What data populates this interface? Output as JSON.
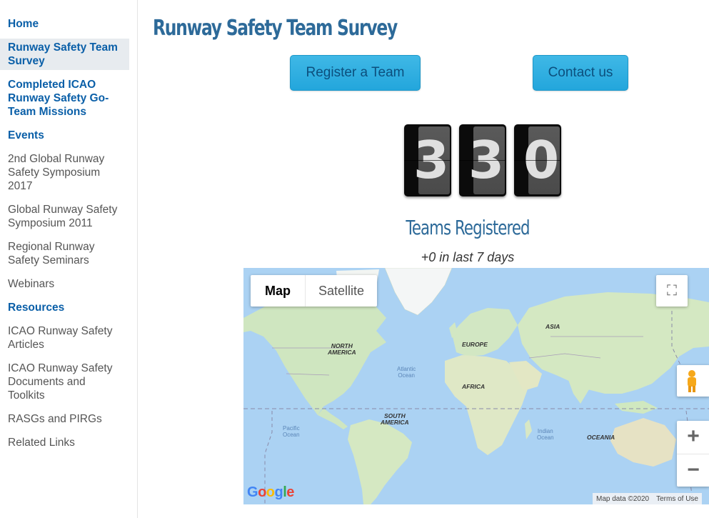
{
  "sidebar": {
    "items": [
      {
        "label": "Home",
        "style": "bold"
      },
      {
        "label": "Runway Safety Team Survey",
        "style": "bold",
        "active": true
      },
      {
        "label": "Completed ICAO Runway Safety Go-Team Missions",
        "style": "bold"
      },
      {
        "label": "Events",
        "style": "bold"
      },
      {
        "label": "2nd Global Runway Safety Symposium 2017",
        "style": "plain"
      },
      {
        "label": "Global Runway Safety Symposium 2011",
        "style": "plain"
      },
      {
        "label": "Regional Runway Safety Seminars",
        "style": "plain"
      },
      {
        "label": "Webinars",
        "style": "plain"
      },
      {
        "label": "Resources",
        "style": "bold"
      },
      {
        "label": "ICAO Runway Safety Articles",
        "style": "plain"
      },
      {
        "label": "ICAO Runway Safety Documents and Toolkits",
        "style": "plain"
      },
      {
        "label": "RASGs and PIRGs",
        "style": "plain"
      },
      {
        "label": "Related Links",
        "style": "plain"
      }
    ]
  },
  "main": {
    "title": "Runway Safety Team Survey",
    "register_button": "Register a Team",
    "contact_button": "Contact us",
    "counter": {
      "digits": [
        "3",
        "3",
        "0"
      ],
      "value": 330
    },
    "counter_label": "Teams Registered",
    "weekly_change": "+0 in last 7 days"
  },
  "map": {
    "type_map": "Map",
    "type_satellite": "Satellite",
    "fullscreen_icon": "⛶",
    "zoom_in": "+",
    "zoom_out": "−",
    "labels": {
      "north_america": "NORTH\nAMERICA",
      "south_america": "SOUTH\nAMERICA",
      "europe": "EUROPE",
      "africa": "AFRICA",
      "asia": "ASIA",
      "oceania": "OCEANIA",
      "atlantic": "Atlantic\nOcean",
      "pacific": "Pacific\nOcean",
      "indian": "Indian\nOcean"
    },
    "logo": "Google",
    "footer_data": "Map data ©2020",
    "footer_terms": "Terms of Use",
    "colors": {
      "water": "#abd2f3",
      "land": "#cfe6c0",
      "ice": "#f4f6f6"
    }
  }
}
